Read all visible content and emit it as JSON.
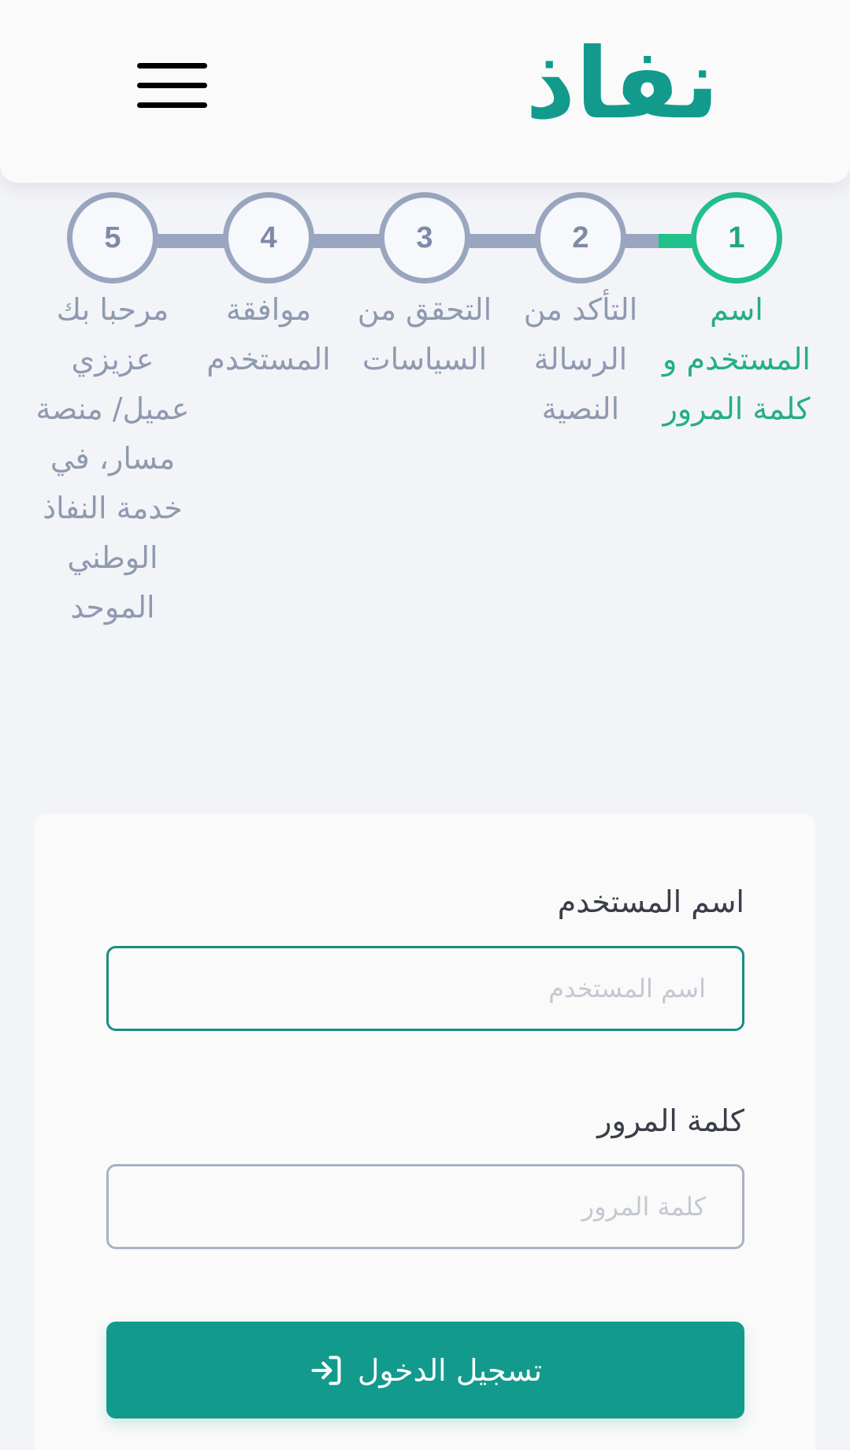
{
  "header": {
    "logo_text": "نفاذ",
    "menu_icon": "hamburger-menu-icon",
    "brand_color": "#129b8c"
  },
  "stepper": {
    "current_step": 1,
    "active_color": "#22c08a",
    "inactive_color": "#9aa6bf",
    "steps": [
      {
        "number": "1",
        "label": "اسم المستخدم و كلمة المرور"
      },
      {
        "number": "2",
        "label": "التأكد من الرسالة النصية"
      },
      {
        "number": "3",
        "label": "التحقق من السياسات"
      },
      {
        "number": "4",
        "label": "موافقة المستخدم"
      },
      {
        "number": "5",
        "label": "مرحبا بك عزيزي عميل/ منصة مسار، في خدمة النفاذ الوطني الموحد"
      }
    ]
  },
  "login_form": {
    "username_label": "اسم المستخدم",
    "username_placeholder": "اسم المستخدم",
    "username_value": "",
    "password_label": "كلمة المرور",
    "password_placeholder": "كلمة المرور",
    "password_value": "",
    "submit_label": "تسجيل الدخول",
    "submit_icon": "login-arrow-icon"
  }
}
